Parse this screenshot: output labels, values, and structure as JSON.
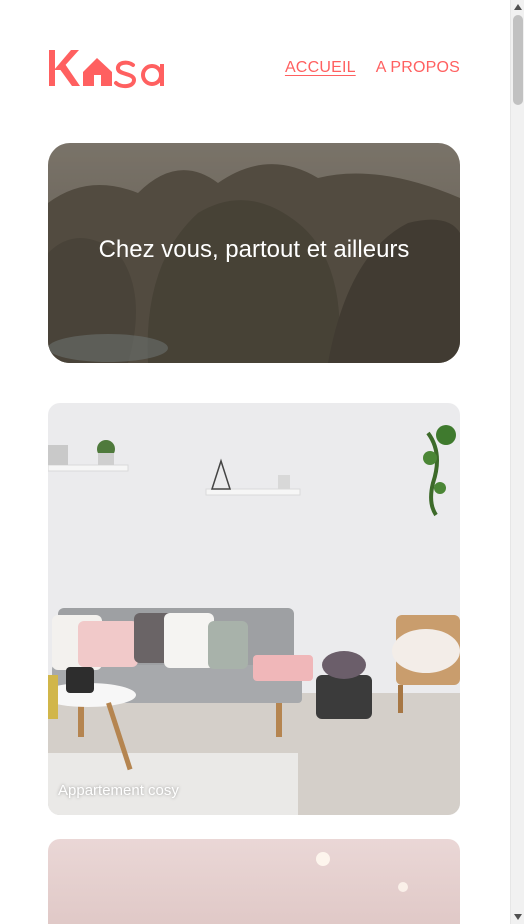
{
  "brand": {
    "name": "Kasa",
    "color": "#ff6060"
  },
  "nav": {
    "items": [
      {
        "label": "ACCUEIL",
        "active": true
      },
      {
        "label": "A PROPOS",
        "active": false
      }
    ]
  },
  "banner": {
    "title": "Chez vous, partout et ailleurs"
  },
  "cards": [
    {
      "title": "Appartement cosy"
    },
    {
      "title": ""
    }
  ],
  "icons": {
    "scroll_up": "triangle-up-icon",
    "scroll_down": "triangle-down-icon"
  }
}
